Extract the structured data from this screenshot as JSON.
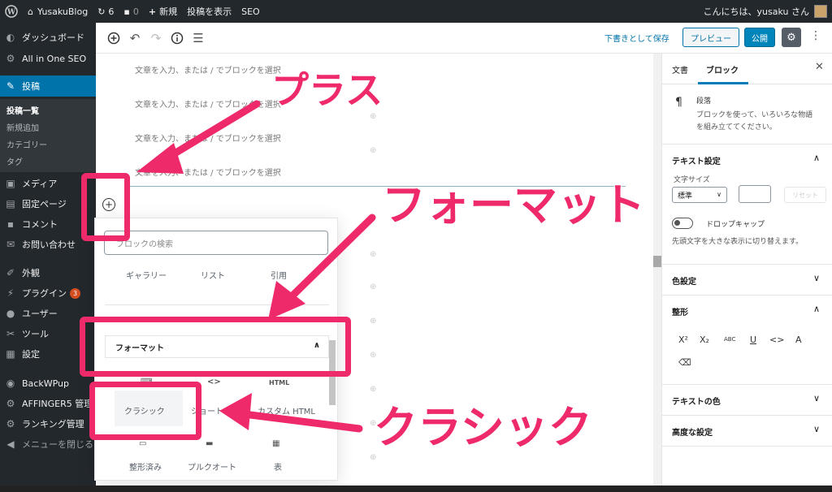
{
  "adminbar": {
    "site_name": "YusakuBlog",
    "updates_count": "6",
    "comments_count": "0",
    "new_label": "新規",
    "view_post": "投稿を表示",
    "seo": "SEO",
    "greeting": "こんにちは、yusaku さん"
  },
  "sidebar": {
    "items": [
      {
        "icon": "dashboard-icon",
        "label": "ダッシュボード"
      },
      {
        "icon": "seo-icon",
        "label": "All in One SEO"
      },
      {
        "icon": "pin-icon",
        "label": "投稿"
      },
      {
        "icon": "media-icon",
        "label": "メディア"
      },
      {
        "icon": "page-icon",
        "label": "固定ページ"
      },
      {
        "icon": "comment-icon",
        "label": "コメント"
      },
      {
        "icon": "mail-icon",
        "label": "お問い合わせ"
      },
      {
        "icon": "appearance-icon",
        "label": "外観"
      },
      {
        "icon": "plugin-icon",
        "label": "プラグイン",
        "badge": "3"
      },
      {
        "icon": "user-icon",
        "label": "ユーザー"
      },
      {
        "icon": "tools-icon",
        "label": "ツール"
      },
      {
        "icon": "settings-icon",
        "label": "設定"
      },
      {
        "icon": "backup-icon",
        "label": "BackWPup"
      },
      {
        "icon": "gear-icon",
        "label": "AFFINGER5 管理"
      },
      {
        "icon": "gear-icon",
        "label": "ランキング管理"
      },
      {
        "icon": "collapse-icon",
        "label": "メニューを閉じる"
      }
    ],
    "submenu": [
      "投稿一覧",
      "新規追加",
      "カテゴリー",
      "タグ"
    ]
  },
  "header": {
    "save_draft": "下書きとして保存",
    "preview": "プレビュー",
    "publish": "公開"
  },
  "content": {
    "placeholders": [
      "文章を入力、または / でブロックを選択",
      "文章を入力、または / でブロックを選択",
      "文章を入力、または / でブロックを選択",
      "文章を入力、または / でブロックを選択"
    ]
  },
  "inserter": {
    "search_placeholder": "ブロックの検索",
    "top_blocks": [
      "ギャラリー",
      "リスト",
      "引用"
    ],
    "category": "フォーマット",
    "blocks": [
      {
        "label": "クラシック",
        "icon": "keyboard-icon"
      },
      {
        "label": "ショートコード",
        "icon": "shortcode-icon"
      },
      {
        "label": "カスタム HTML",
        "icon": "html-icon",
        "icon_text": "HTML"
      },
      {
        "label": "整形済み",
        "icon": "preformatted-icon"
      },
      {
        "label": "プルクオート",
        "icon": "pullquote-icon"
      },
      {
        "label": "表",
        "icon": "table-icon"
      }
    ]
  },
  "panel": {
    "tab_document": "文書",
    "tab_block": "ブロック",
    "block_name": "段落",
    "block_desc_1": "ブロックを使って、いろいろな物語",
    "block_desc_2": "を組み立ててください。",
    "text_settings": "テキスト設定",
    "font_size_label": "文字サイズ",
    "font_size_value": "標準",
    "reset": "リセット",
    "drop_cap": "ドロップキャップ",
    "drop_cap_help": "先頭文字を大きな表示に切り替えます。",
    "color_settings": "色設定",
    "formatting": "整形",
    "text_color": "テキストの色",
    "advanced": "高度な設定",
    "format_buttons": [
      "X²",
      "X₂",
      "ABC",
      "U",
      "<>",
      "A"
    ]
  },
  "annotations": {
    "plus": "プラス",
    "format": "フォーマット",
    "classic": "クラシック",
    "accent_color": "#ee2a6a"
  }
}
